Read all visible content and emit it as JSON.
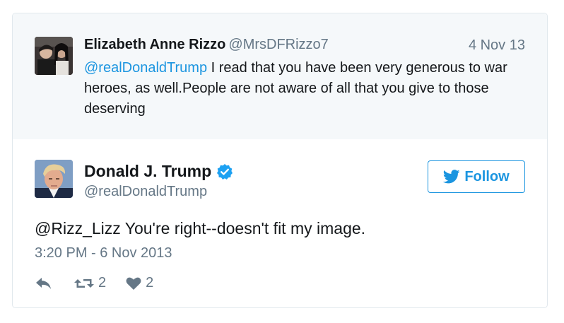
{
  "reply": {
    "author_name": "Elizabeth Anne Rizzo",
    "author_handle": "@MrsDFRizzo7",
    "date": "4 Nov 13",
    "mention": "@realDonaldTrump",
    "text": " I read that you have been very generous to war heroes, as well.People are not aware of all that you give to those deserving"
  },
  "tweet": {
    "author_name": "Donald J. Trump",
    "author_handle": "@realDonaldTrump",
    "verified_icon": "verified-badge-icon",
    "follow_label": "Follow",
    "text": "@Rizz_Lizz You're right--doesn't fit my image.",
    "timestamp": "3:20 PM - 6 Nov 2013",
    "retweet_count": "2",
    "like_count": "2"
  },
  "colors": {
    "accent": "#1b95e0",
    "muted_text": "#657786",
    "reply_background": "#f5f8fa",
    "border": "#e1e8ed"
  }
}
